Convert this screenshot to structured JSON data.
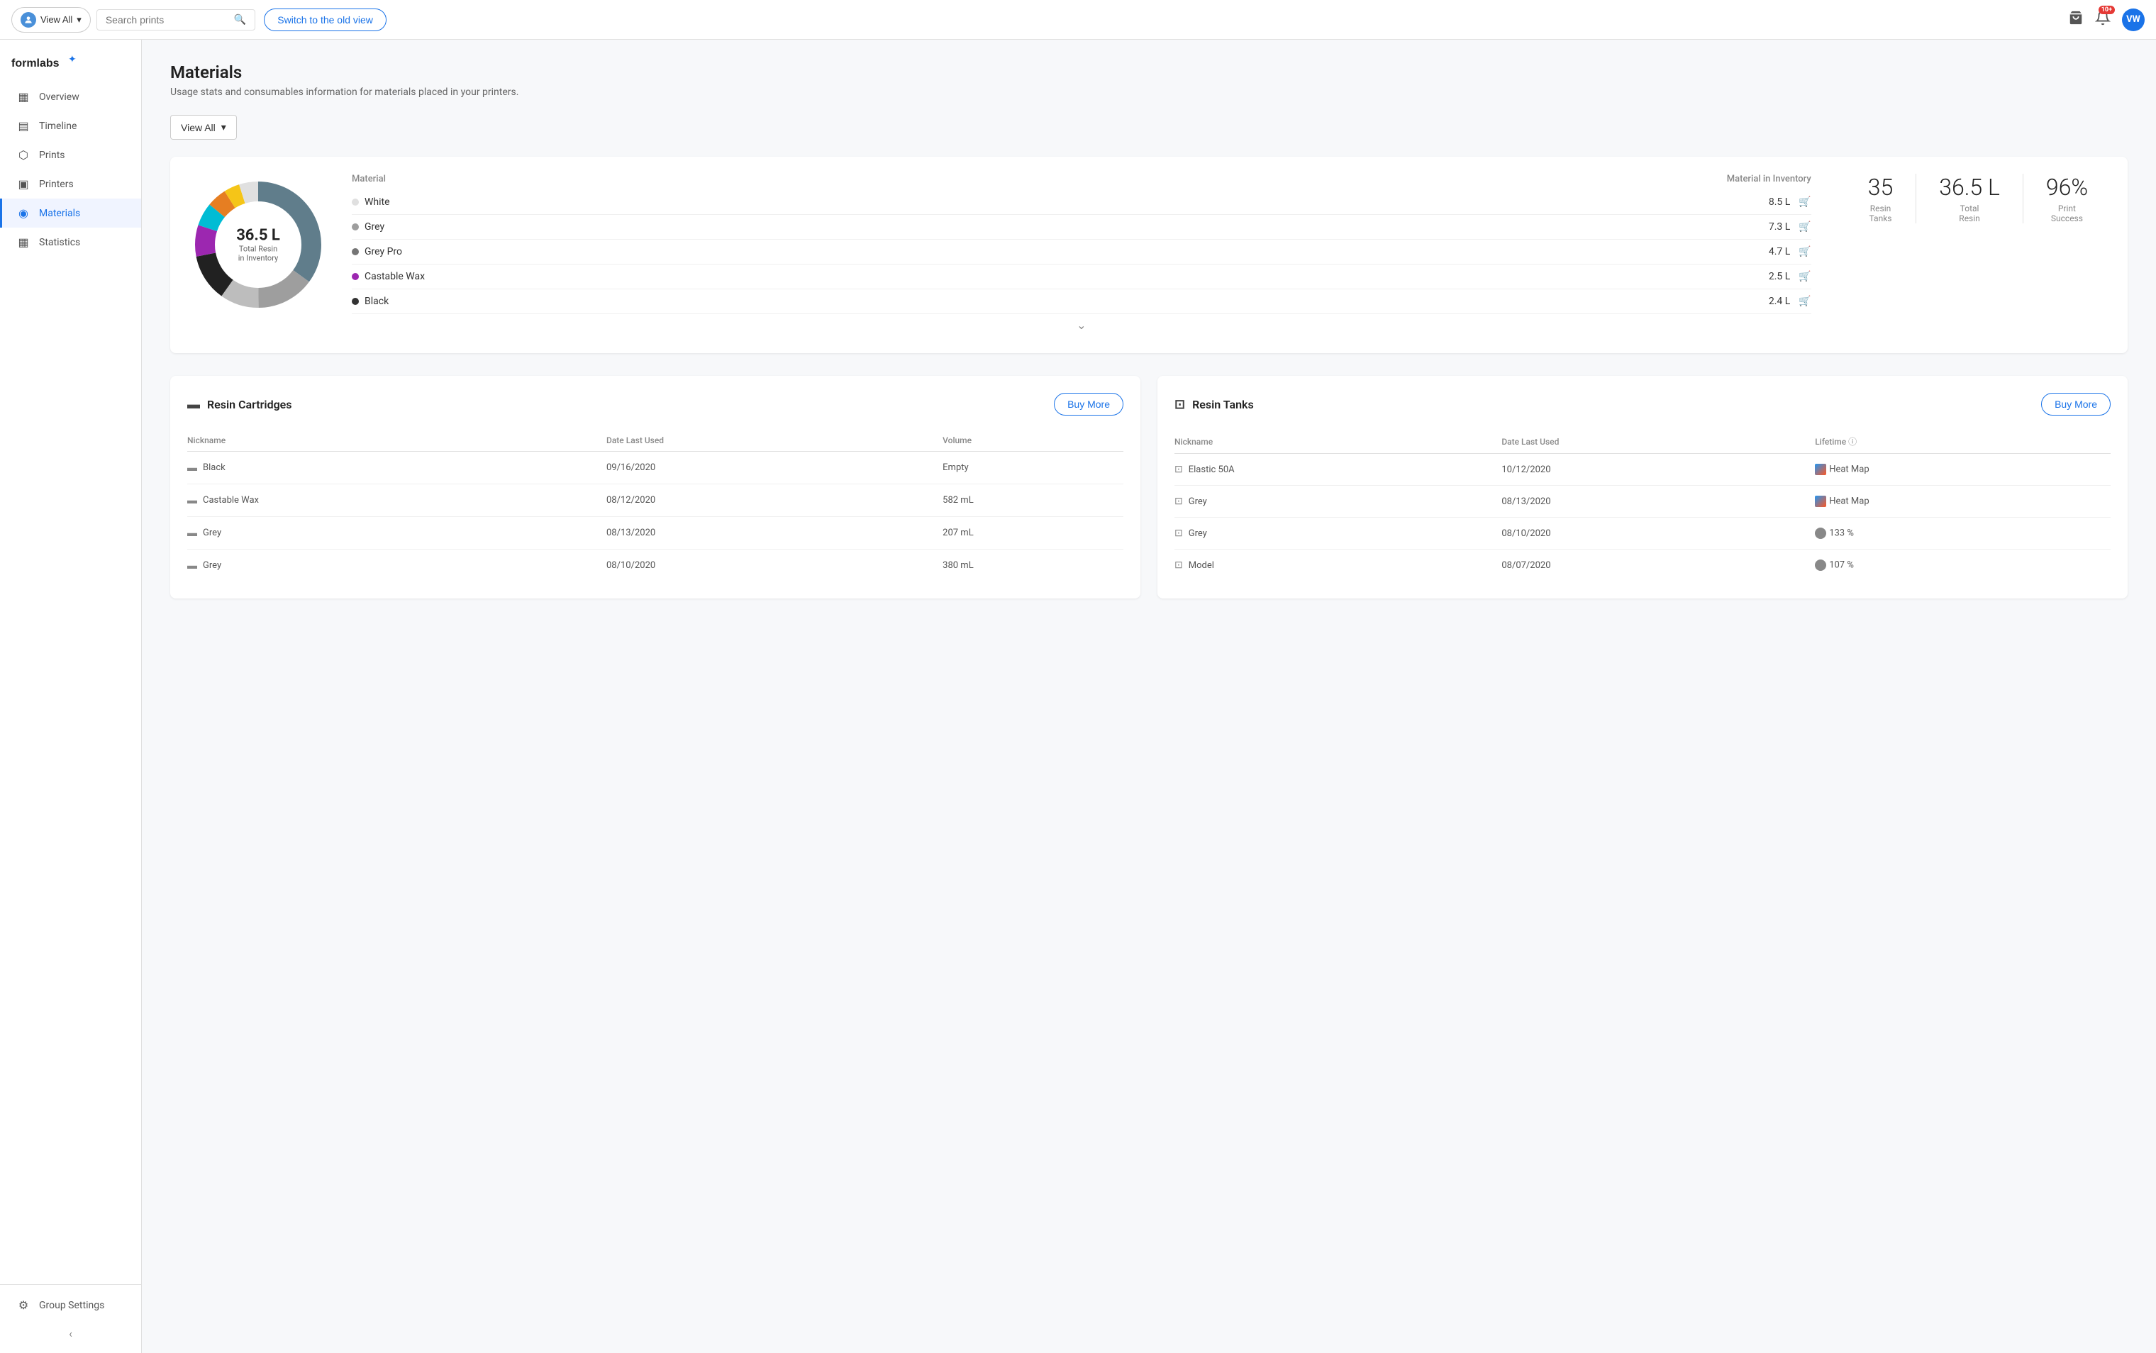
{
  "app": {
    "logo": "formlabs",
    "logo_icon": "✦"
  },
  "topbar": {
    "view_all_label": "View All",
    "search_placeholder": "Search prints",
    "switch_btn_label": "Switch to the old view",
    "bell_badge": "10+",
    "user_initials": "VW"
  },
  "sidebar": {
    "items": [
      {
        "id": "overview",
        "label": "Overview",
        "icon": "▦"
      },
      {
        "id": "timeline",
        "label": "Timeline",
        "icon": "▤"
      },
      {
        "id": "prints",
        "label": "Prints",
        "icon": "⬡"
      },
      {
        "id": "printers",
        "label": "Printers",
        "icon": "▣"
      },
      {
        "id": "materials",
        "label": "Materials",
        "icon": "◉",
        "active": true
      },
      {
        "id": "statistics",
        "label": "Statistics",
        "icon": "▦"
      }
    ],
    "bottom": {
      "group_settings_label": "Group Settings",
      "collapse_icon": "‹"
    }
  },
  "page": {
    "title": "Materials",
    "subtitle": "Usage stats and consumables information for materials placed in your printers."
  },
  "filter": {
    "view_all_label": "View All",
    "dropdown_arrow": "▾"
  },
  "donut": {
    "value": "36.5 L",
    "label1": "Total Resin",
    "label2": "in Inventory",
    "segments": [
      {
        "color": "#607d8b",
        "pct": 35
      },
      {
        "color": "#9e9e9e",
        "pct": 15
      },
      {
        "color": "#bdbdbd",
        "pct": 10
      },
      {
        "color": "#212121",
        "pct": 12
      },
      {
        "color": "#9c27b0",
        "pct": 8
      },
      {
        "color": "#00bcd4",
        "pct": 6
      },
      {
        "color": "#e67e22",
        "pct": 5
      },
      {
        "color": "#f5c518",
        "pct": 4
      },
      {
        "color": "#e0e0e0",
        "pct": 5
      }
    ]
  },
  "materials_table": {
    "col1": "Material",
    "col2": "Material in Inventory",
    "rows": [
      {
        "name": "White",
        "color": "#e0e0e0",
        "volume": "8.5 L",
        "cart_active": true
      },
      {
        "name": "Grey",
        "color": "#9e9e9e",
        "volume": "7.3 L",
        "cart_active": true
      },
      {
        "name": "Grey Pro",
        "color": "#757575",
        "volume": "4.7 L",
        "cart_active": true
      },
      {
        "name": "Castable Wax",
        "color": "#9c27b0",
        "volume": "2.5 L",
        "cart_active": true
      },
      {
        "name": "Black",
        "color": "#333333",
        "volume": "2.4 L",
        "cart_active": false
      }
    ],
    "expand_icon": "⌄"
  },
  "summary_stats": [
    {
      "value": "35",
      "label1": "Resin",
      "label2": "Tanks"
    },
    {
      "value": "36.5 L",
      "label1": "Total",
      "label2": "Resin"
    },
    {
      "value": "96%",
      "label1": "Print",
      "label2": "Success"
    }
  ],
  "resin_cartridges": {
    "title": "Resin Cartridges",
    "buy_btn": "Buy More",
    "cols": [
      "Nickname",
      "Date Last Used",
      "Volume"
    ],
    "rows": [
      {
        "nickname": "Black",
        "date": "09/16/2020",
        "volume": "Empty"
      },
      {
        "nickname": "Castable Wax",
        "date": "08/12/2020",
        "volume": "582 mL"
      },
      {
        "nickname": "Grey",
        "date": "08/13/2020",
        "volume": "207 mL"
      },
      {
        "nickname": "Grey",
        "date": "08/10/2020",
        "volume": "380 mL"
      }
    ]
  },
  "resin_tanks": {
    "title": "Resin Tanks",
    "buy_btn": "Buy More",
    "cols": [
      "Nickname",
      "Date Last Used",
      "Lifetime"
    ],
    "rows": [
      {
        "nickname": "Elastic 50A",
        "date": "10/12/2020",
        "lifetime": "Heat Map",
        "lifetime_type": "heatmap"
      },
      {
        "nickname": "Grey",
        "date": "08/13/2020",
        "lifetime": "Heat Map",
        "lifetime_type": "heatmap"
      },
      {
        "nickname": "Grey",
        "date": "08/10/2020",
        "lifetime": "133 %",
        "lifetime_type": "pct"
      },
      {
        "nickname": "Model",
        "date": "08/07/2020",
        "lifetime": "107 %",
        "lifetime_type": "pct"
      }
    ]
  }
}
